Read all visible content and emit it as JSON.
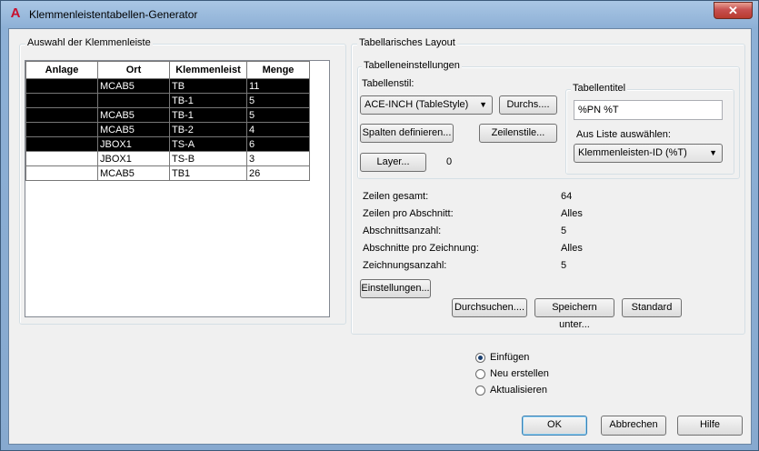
{
  "window": {
    "title": "Klemmenleistentabellen-Generator",
    "close": "✕",
    "app_icon": "A"
  },
  "left_group": {
    "label": "Auswahl der Klemmenleiste",
    "columns": [
      "Anlage",
      "Ort",
      "Klemmenleist",
      "Menge"
    ],
    "rows": [
      {
        "anlage": "",
        "ort": "MCAB5",
        "klemmenleiste": "TB",
        "menge": "11",
        "selected": true
      },
      {
        "anlage": "",
        "ort": "",
        "klemmenleiste": "TB-1",
        "menge": "5",
        "selected": true
      },
      {
        "anlage": "",
        "ort": "MCAB5",
        "klemmenleiste": "TB-1",
        "menge": "5",
        "selected": true
      },
      {
        "anlage": "",
        "ort": "MCAB5",
        "klemmenleiste": "TB-2",
        "menge": "4",
        "selected": true
      },
      {
        "anlage": "",
        "ort": "JBOX1",
        "klemmenleiste": "TS-A",
        "menge": "6",
        "selected": true
      },
      {
        "anlage": "",
        "ort": "JBOX1",
        "klemmenleiste": "TS-B",
        "menge": "3",
        "selected": false
      },
      {
        "anlage": "",
        "ort": "MCAB5",
        "klemmenleiste": "TB1",
        "menge": "26",
        "selected": false
      }
    ]
  },
  "right_group": {
    "label": "Tabellarisches Layout",
    "settings": {
      "label": "Tabelleneinstellungen",
      "table_style_label": "Tabellenstil:",
      "table_style_value": "ACE-INCH (TableStyle)",
      "browse_button": "Durchs....",
      "define_columns_button": "Spalten definieren...",
      "row_styles_button": "Zeilenstile...",
      "layer_button": "Layer...",
      "layer_count": "0"
    },
    "title_box": {
      "label": "Tabellentitel",
      "value": "%PN %T",
      "pick_label": "Aus Liste auswählen:",
      "pick_value": "Klemmenleisten-ID (%T)"
    },
    "stats": [
      {
        "label": "Zeilen gesamt:",
        "value": "64"
      },
      {
        "label": "Zeilen pro Abschnitt:",
        "value": "Alles"
      },
      {
        "label": "Abschnittsanzahl:",
        "value": "5"
      },
      {
        "label": "Abschnitte pro Zeichnung:",
        "value": "Alles"
      },
      {
        "label": "Zeichnungsanzahl:",
        "value": "5"
      }
    ],
    "settings_button": "Einstellungen...",
    "search_button": "Durchsuchen....",
    "save_as_button": "Speichern unter...",
    "standard_button": "Standard"
  },
  "options": {
    "insert": "Einfügen",
    "create_new": "Neu erstellen",
    "update": "Aktualisieren",
    "selected": "insert"
  },
  "footer": {
    "ok": "OK",
    "cancel": "Abbrechen",
    "help": "Hilfe"
  },
  "colors": {
    "selection": "#000000",
    "accent_border": "#3c7fb1"
  }
}
